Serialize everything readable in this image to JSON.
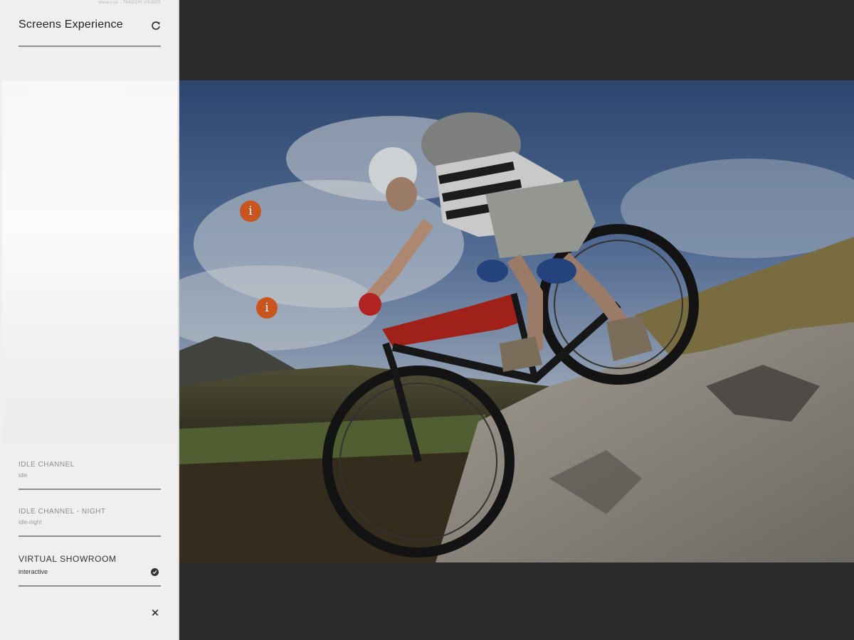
{
  "panel": {
    "top_caption": "www.cue - TANDEM VIEWER",
    "title": "Screens Experience",
    "refresh_icon": "refresh-icon",
    "channels": [
      {
        "label": "IDLE CHANNEL",
        "sub": "idle"
      },
      {
        "label": "IDLE CHANNEL - NIGHT",
        "sub": "idle-night"
      },
      {
        "label": "VIRTUAL SHOWROOM",
        "sub": "interactive",
        "selected": true
      }
    ],
    "selected_icon": "check-circle-icon",
    "close_icon": "close-icon"
  },
  "stage": {
    "image_subject": "mountain-biker-descending-rocks",
    "hotspots": [
      {
        "label": "i"
      },
      {
        "label": "i"
      }
    ],
    "accent_color": "#c8551f"
  }
}
